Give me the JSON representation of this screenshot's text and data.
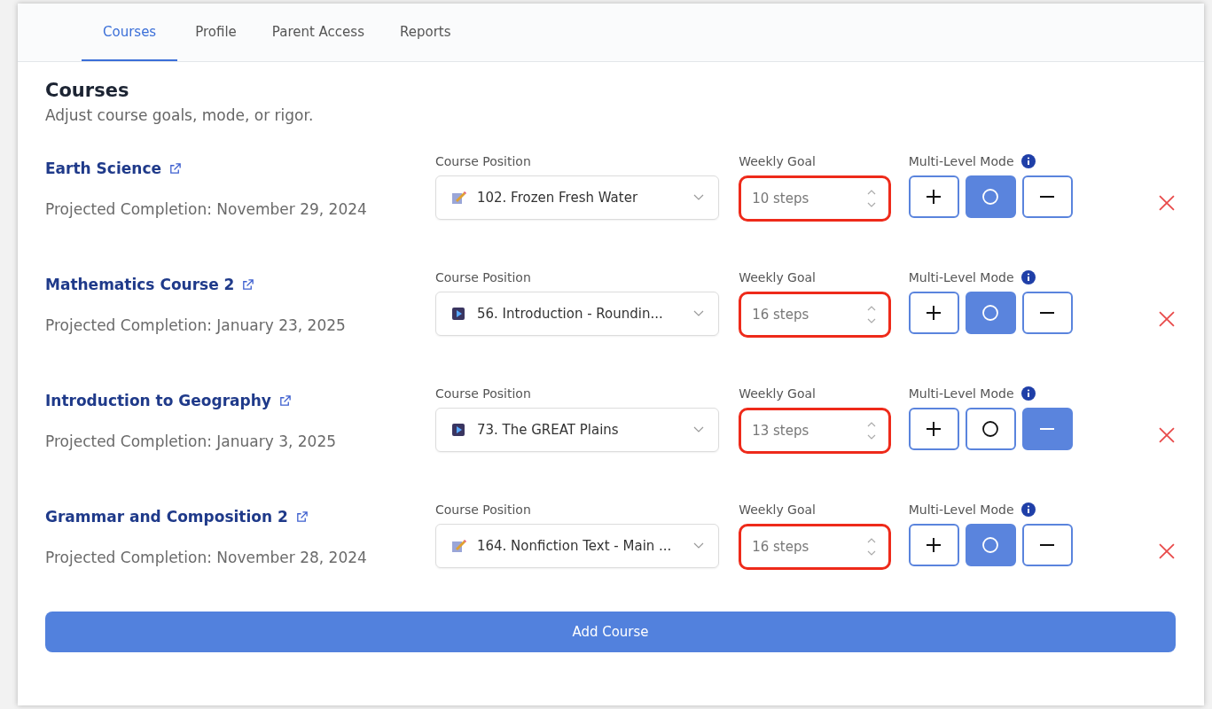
{
  "tabs": [
    {
      "label": "Courses",
      "selected": true
    },
    {
      "label": "Profile",
      "selected": false
    },
    {
      "label": "Parent Access",
      "selected": false
    },
    {
      "label": "Reports",
      "selected": false
    }
  ],
  "header": {
    "title": "Courses",
    "subtitle": "Adjust course goals, mode, or rigor."
  },
  "courses": [
    {
      "name": "Earth Science",
      "completion": "Projected Completion: November 29, 2024",
      "position_label": "Course Position",
      "position": {
        "kind": "writing",
        "text": "102. Frozen Fresh Water"
      },
      "goal_label": "Weekly Goal",
      "goal": {
        "value": "10 steps",
        "invalid": true
      },
      "mode_label": "Multi-Level Mode",
      "modes": [
        {
          "kind": "plus",
          "selected": false
        },
        {
          "kind": "circle",
          "selected": true
        },
        {
          "kind": "minus",
          "selected": false
        }
      ]
    },
    {
      "name": "Mathematics Course 2",
      "completion": "Projected Completion: January 23, 2025",
      "position_label": "Course Position",
      "position": {
        "kind": "video",
        "text": "56. Introduction - Roundin..."
      },
      "goal_label": "Weekly Goal",
      "goal": {
        "value": "16 steps",
        "invalid": true
      },
      "mode_label": "Multi-Level Mode",
      "modes": [
        {
          "kind": "plus",
          "selected": false
        },
        {
          "kind": "circle",
          "selected": true
        },
        {
          "kind": "minus",
          "selected": false
        }
      ]
    },
    {
      "name": "Introduction to Geography",
      "completion": "Projected Completion: January 3, 2025",
      "position_label": "Course Position",
      "position": {
        "kind": "video",
        "text": "73. The GREAT Plains"
      },
      "goal_label": "Weekly Goal",
      "goal": {
        "value": "13 steps",
        "invalid": true
      },
      "mode_label": "Multi-Level Mode",
      "modes": [
        {
          "kind": "plus",
          "selected": false
        },
        {
          "kind": "circle",
          "selected": false
        },
        {
          "kind": "minus",
          "selected": true
        }
      ]
    },
    {
      "name": "Grammar and Composition 2",
      "completion": "Projected Completion: November 28, 2024",
      "position_label": "Course Position",
      "position": {
        "kind": "writing",
        "text": "164. Nonfiction Text - Main ..."
      },
      "goal_label": "Weekly Goal",
      "goal": {
        "value": "16 steps",
        "invalid": true
      },
      "mode_label": "Multi-Level Mode",
      "modes": [
        {
          "kind": "plus",
          "selected": false
        },
        {
          "kind": "circle",
          "selected": true
        },
        {
          "kind": "minus",
          "selected": false
        }
      ]
    }
  ],
  "add_button": "Add Course"
}
